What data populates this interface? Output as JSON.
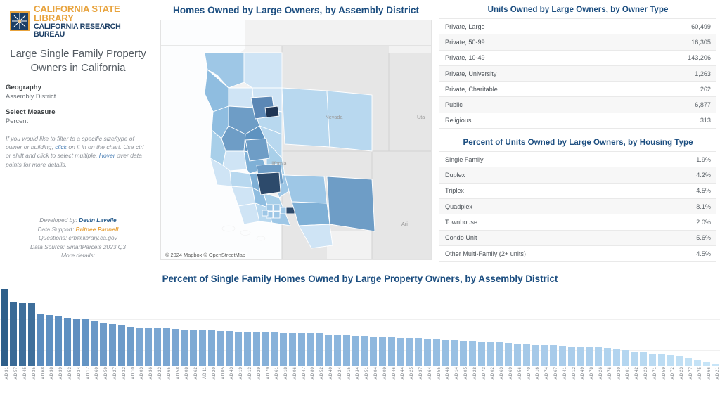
{
  "logo": {
    "line1": "CALIFORNIA STATE LIBRARY",
    "line2": "CALIFORNIA RESEARCH BUREAU",
    "mark_bg": "#1c3f66",
    "mark_border": "#e8a33d"
  },
  "sidebar": {
    "dashboard_title": "Large Single Family Property Owners in California",
    "geography_label": "Geography",
    "geography_value": "Assembly District",
    "measure_label": "Select Measure",
    "measure_value": "Percent",
    "hint_part1": "If you would like to filter to a specific size/type of owner or building,",
    "hint_link1": "click",
    "hint_part2": "on it in on the chart. Use ctrl or shift and click to select multiple.",
    "hint_link2": "Hover",
    "hint_part3": "over data points for more details.",
    "credit_developed_label": "Developed by:",
    "credit_developed_name": "Devin Lavelle",
    "credit_support_label": "Data Support:",
    "credit_support_name": "Britnee Pannell",
    "credit_questions": "Questions: crb@library.ca.gov",
    "credit_source": "Data Source: SmartParcels 2023 Q3",
    "credit_more": "More details:"
  },
  "map": {
    "title": "Homes Owned by Large Owners, by Assembly District",
    "attribution": "© 2024 Mapbox © OpenStreetMap",
    "state_labels": [
      "Nevada",
      "Uta",
      "California",
      "Ari"
    ]
  },
  "owner_table": {
    "title": "Units Owned by Large Owners, by Owner Type",
    "rows": [
      {
        "label": "Private, Large",
        "value": "60,499"
      },
      {
        "label": "Private, 50-99",
        "value": "16,305"
      },
      {
        "label": "Private, 10-49",
        "value": "143,206"
      },
      {
        "label": "Private, University",
        "value": "1,263"
      },
      {
        "label": "Private, Charitable",
        "value": "262"
      },
      {
        "label": "Public",
        "value": "6,877"
      },
      {
        "label": "Religious",
        "value": "313"
      }
    ]
  },
  "housing_table": {
    "title": "Percent of Units Owned by Large Owners, by Housing Type",
    "rows": [
      {
        "label": "Single Family",
        "value": "1.9%"
      },
      {
        "label": "Duplex",
        "value": "4.2%"
      },
      {
        "label": "Triplex",
        "value": "4.5%"
      },
      {
        "label": "Quadplex",
        "value": "8.1%"
      },
      {
        "label": "Townhouse",
        "value": "2.0%"
      },
      {
        "label": "Condo Unit",
        "value": "5.6%"
      },
      {
        "label": "Other Multi-Family (2+ units)",
        "value": "4.5%"
      }
    ]
  },
  "chart_data": {
    "type": "bar",
    "title": "Percent of Single Family Homes Owned by Large Property Owners, by Assembly District",
    "xlabel": "",
    "ylabel": "",
    "grid": true,
    "ylim": [
      0,
      5.0
    ],
    "categories": [
      "AD 31",
      "AD 57",
      "AD 45",
      "AD 35",
      "AD 68",
      "AD 38",
      "AD 39",
      "AD 53",
      "AD 34",
      "AD 17",
      "AD 60",
      "AD 50",
      "AD 27",
      "AD 32",
      "AD 10",
      "AD 03",
      "AD 36",
      "AD 22",
      "AD 65",
      "AD 58",
      "AD 08",
      "AD 62",
      "AD 11",
      "AD 20",
      "AD 05",
      "AD 43",
      "AD 19",
      "AD 13",
      "AD 29",
      "AD 79",
      "AD 61",
      "AD 18",
      "AD 06",
      "AD 47",
      "AD 80",
      "AD 52",
      "AD 40",
      "AD 24",
      "AD 15",
      "AD 34",
      "AD 51",
      "AD 04",
      "AD 09",
      "AD 46",
      "AD 44",
      "AD 25",
      "AD 37",
      "AD 64",
      "AD 55",
      "AD 48",
      "AD 14",
      "AD 05",
      "AD 28",
      "AD 73",
      "AD 02",
      "AD 63",
      "AD 69",
      "AD 56",
      "AD 70",
      "AD 16",
      "AD 74",
      "AD 67",
      "AD 41",
      "AD 12",
      "AD 49",
      "AD 78",
      "AD 26",
      "AD 76",
      "AD 30",
      "AD 01",
      "AD 42",
      "AD 23",
      "AD 71",
      "AD 59",
      "AD 72",
      "AD 23",
      "AD 77",
      "AD 75",
      "AD 66",
      "AD 21"
    ],
    "values": [
      4.95,
      4.08,
      4.05,
      4.03,
      3.38,
      3.27,
      3.16,
      3.1,
      3.05,
      3.02,
      2.88,
      2.76,
      2.7,
      2.62,
      2.52,
      2.47,
      2.42,
      2.4,
      2.4,
      2.38,
      2.33,
      2.31,
      2.3,
      2.26,
      2.25,
      2.24,
      2.2,
      2.19,
      2.18,
      2.17,
      2.16,
      2.15,
      2.13,
      2.12,
      2.1,
      2.08,
      1.98,
      1.96,
      1.94,
      1.92,
      1.9,
      1.88,
      1.87,
      1.85,
      1.8,
      1.78,
      1.76,
      1.74,
      1.72,
      1.68,
      1.62,
      1.6,
      1.57,
      1.55,
      1.53,
      1.5,
      1.46,
      1.42,
      1.4,
      1.37,
      1.34,
      1.3,
      1.28,
      1.25,
      1.23,
      1.21,
      1.18,
      1.12,
      1.05,
      0.98,
      0.92,
      0.85,
      0.78,
      0.72,
      0.66,
      0.58,
      0.48,
      0.36,
      0.22,
      0.12
    ],
    "bar_colors": [
      "#2e5f8a",
      "#3a6a96",
      "#3f6f9b",
      "#3f6f9b",
      "#5b8cbe",
      "#5f90c1",
      "#5f90c1",
      "#5f90c1",
      "#618fc0",
      "#6394c4",
      "#6a98c7",
      "#6d9bc9",
      "#6d9bc9",
      "#6d9bc9",
      "#6f9dca",
      "#7aa6d2",
      "#7aa6d2",
      "#7aa6d2",
      "#7aa6d2",
      "#7aa6d2",
      "#7eaad4",
      "#7eaad4",
      "#80acd6",
      "#80acd6",
      "#83add7",
      "#83add7",
      "#85b0d9",
      "#85b0d9",
      "#85b0d9",
      "#85b0d9",
      "#88b2da",
      "#88b2da",
      "#88b2da",
      "#88b2da",
      "#8ab4dc",
      "#8ab4dc",
      "#8cb6dd",
      "#8cb6dd",
      "#8cb6dd",
      "#8cb6dd",
      "#8fb8de",
      "#8fb8de",
      "#8fb8de",
      "#8fb8de",
      "#92bae0",
      "#92bae0",
      "#94bce1",
      "#94bce1",
      "#96bee2",
      "#96bee2",
      "#99c0e3",
      "#99c0e3",
      "#9cc3e5",
      "#9cc3e5",
      "#9fc5e6",
      "#9fc5e6",
      "#a2c7e7",
      "#a2c7e7",
      "#a5c9e8",
      "#a5c9e8",
      "#a8cbea",
      "#a8cbea",
      "#aacdeb",
      "#aacdeb",
      "#accfec",
      "#accfec",
      "#aed1ed",
      "#b0d3ee",
      "#b2d4ef",
      "#b4d6f0",
      "#b6d7f0",
      "#b8d9f1",
      "#badaf2",
      "#bcdcf3",
      "#bedef4",
      "#c0dff4",
      "#c2e1f5",
      "#c4e2f6",
      "#c6e4f7",
      "#c8e5f8"
    ]
  }
}
